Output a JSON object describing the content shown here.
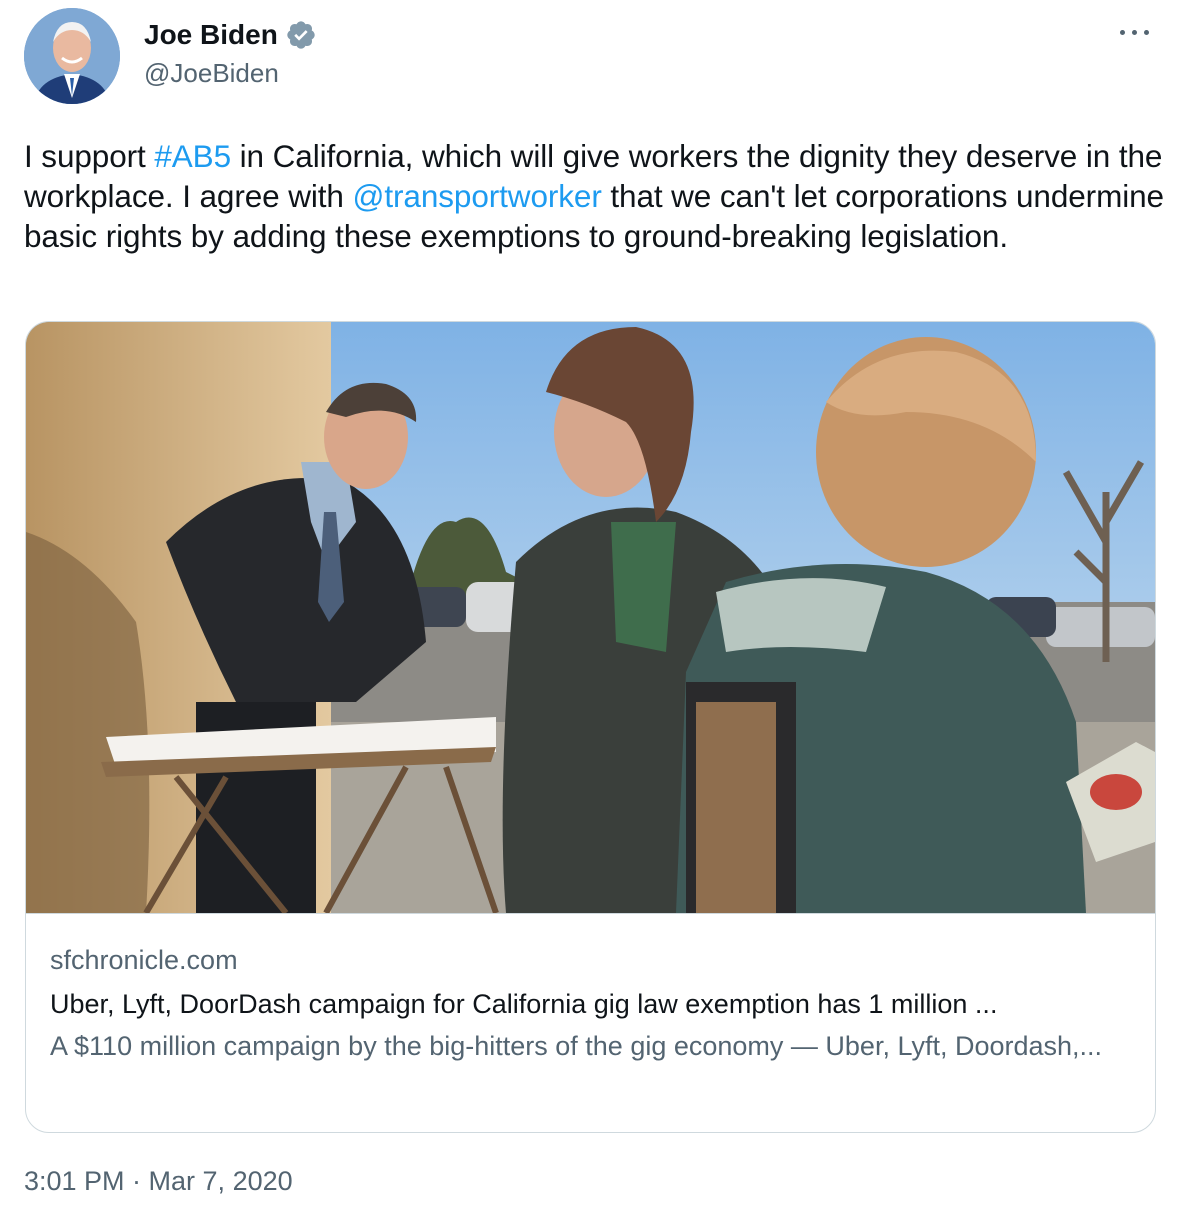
{
  "author": {
    "name": "Joe Biden",
    "handle": "@JoeBiden",
    "verified": true,
    "verified_color": "#829aab"
  },
  "more_icon": "more-horizontal-icon",
  "tweet": {
    "parts": [
      {
        "text": "I support ",
        "type": "text"
      },
      {
        "text": "#AB5",
        "type": "hashtag"
      },
      {
        "text": " in California, which will give workers the dignity they deserve in the workplace. I agree with ",
        "type": "text"
      },
      {
        "text": "@transportworker",
        "type": "mention"
      },
      {
        "text": " that we can't let corporations undermine basic rights by adding these exemptions to ground-breaking legislation.",
        "type": "text"
      }
    ]
  },
  "link_card": {
    "domain": "sfchronicle.com",
    "title": "Uber, Lyft, DoorDash campaign for California gig law exemption has 1 million ...",
    "description": "A $110 million campaign by the big-hitters of the gig economy — Uber, Lyft, Doordash,..."
  },
  "timestamp": "3:01 PM · Mar 7, 2020",
  "colors": {
    "link": "#1d9bf0",
    "secondary_text": "#536471",
    "primary_text": "#0f1419",
    "border": "#cfd9de"
  }
}
